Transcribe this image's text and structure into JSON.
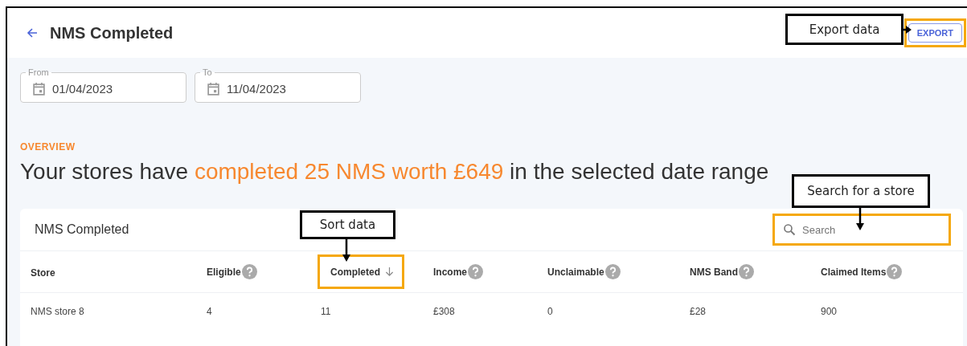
{
  "header": {
    "title": "NMS Completed",
    "export_button": "EXPORT"
  },
  "date_fields": [
    {
      "label": "From",
      "value": "01/04/2023"
    },
    {
      "label": "To",
      "value": "11/04/2023"
    }
  ],
  "overview": {
    "label": "OVERVIEW",
    "headline": [
      {
        "text": "Your stores have ",
        "highlighted": false
      },
      {
        "text": "completed 25 NMS worth £649",
        "highlighted": true
      },
      {
        "text": " in the selected date range",
        "highlighted": false
      }
    ]
  },
  "table": {
    "title": "NMS Completed",
    "search": {
      "placeholder": "Search"
    },
    "columns": [
      {
        "label": "Store",
        "help": false,
        "sorted": false
      },
      {
        "label": "Eligible",
        "help": true,
        "sorted": false
      },
      {
        "label": "Completed",
        "help": false,
        "sorted": true
      },
      {
        "label": "Income",
        "help": true,
        "sorted": false
      },
      {
        "label": "Unclaimable",
        "help": true,
        "sorted": false
      },
      {
        "label": "NMS Band",
        "help": true,
        "sorted": false
      },
      {
        "label": "Claimed Items",
        "help": true,
        "sorted": false
      }
    ],
    "rows": [
      [
        "NMS store 8",
        "4",
        "11",
        "£308",
        "0",
        "£28",
        "900"
      ]
    ]
  },
  "callouts": [
    {
      "text": "Export data",
      "kind": "export"
    },
    {
      "text": "Search for a store",
      "kind": "search"
    },
    {
      "text": "Sort data",
      "kind": "sort"
    }
  ]
}
